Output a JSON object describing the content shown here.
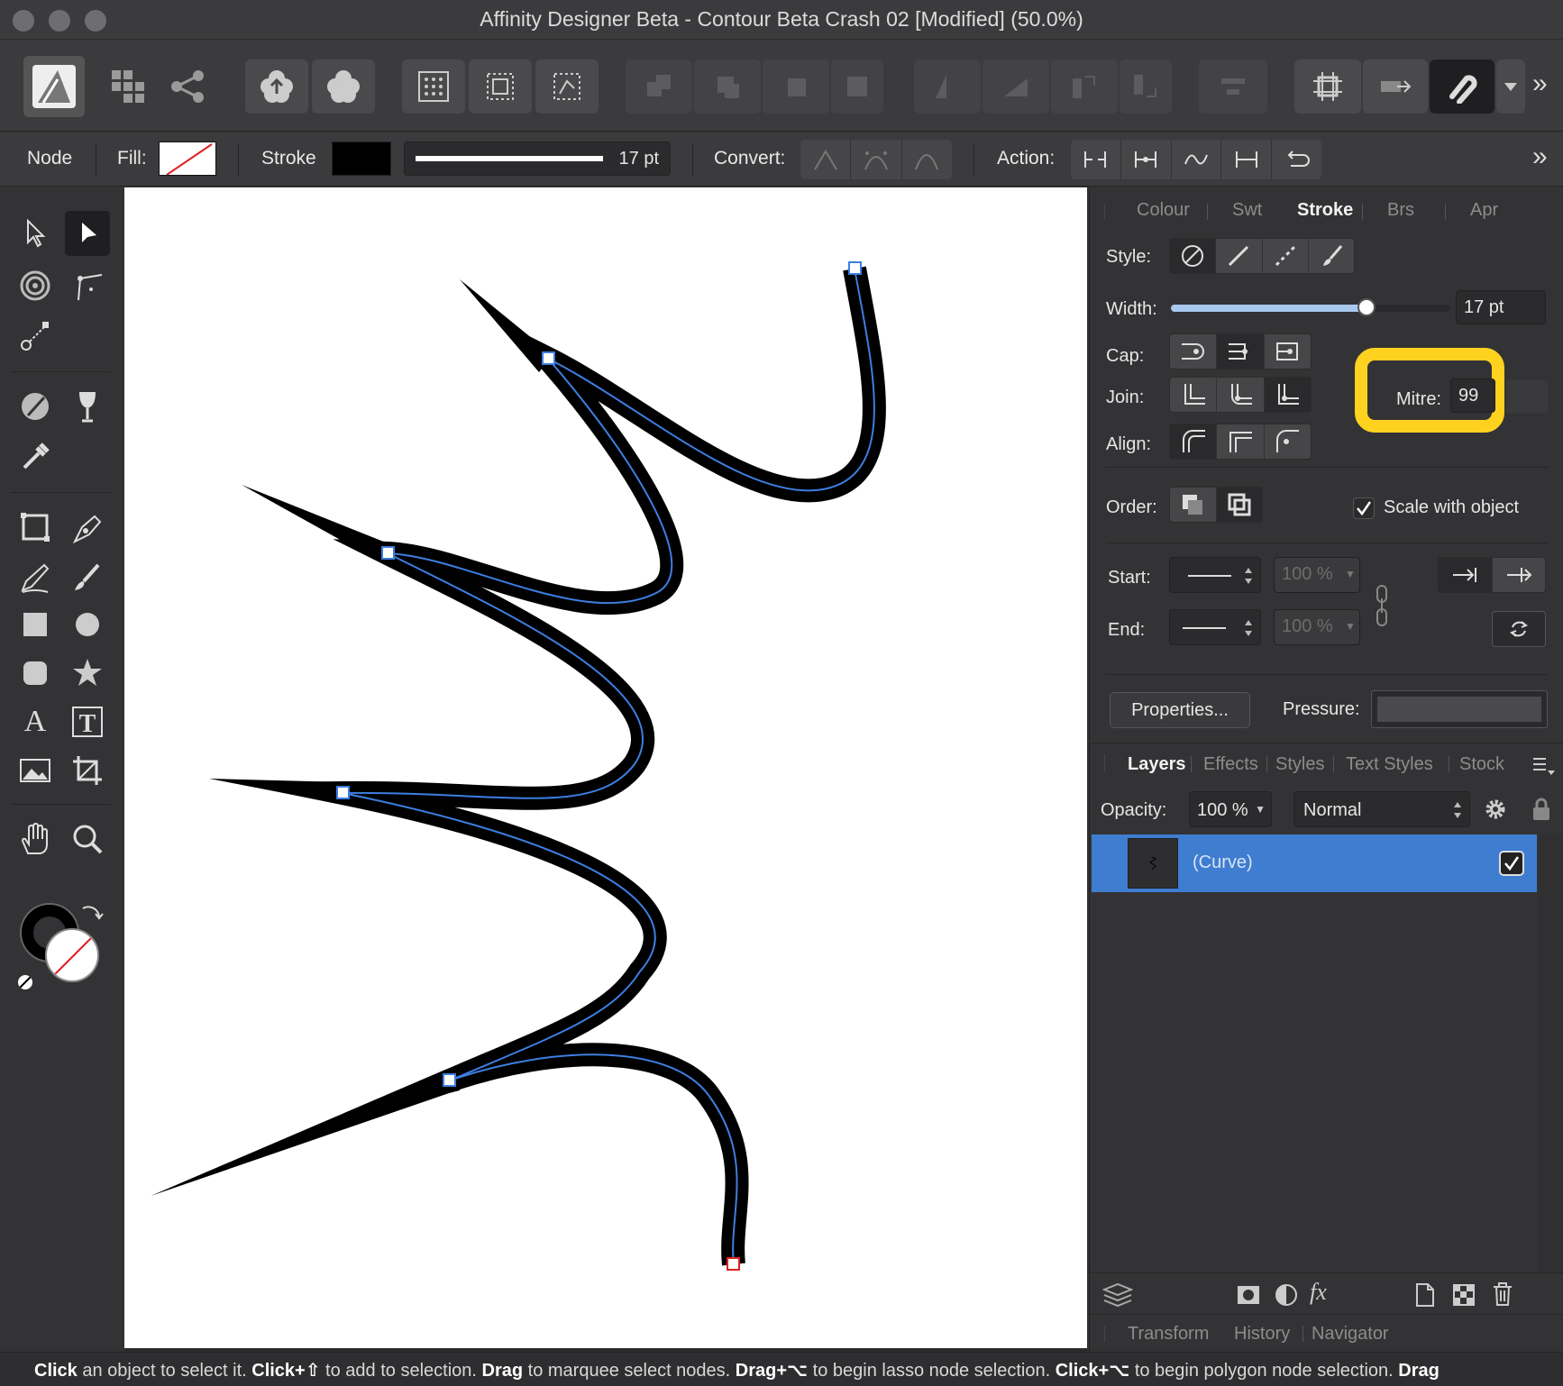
{
  "window": {
    "title": "Affinity Designer Beta - Contour Beta Crash 02 [Modified] (50.0%)"
  },
  "context_toolbar": {
    "mode_label": "Node",
    "fill_label": "Fill:",
    "stroke_label": "Stroke",
    "stroke_width_value": "17 pt",
    "convert_label": "Convert:",
    "action_label": "Action:"
  },
  "stroke_panel": {
    "tabs": [
      "Colour",
      "Swt",
      "Stroke",
      "Brs",
      "Apr"
    ],
    "active_tab": "Stroke",
    "style_label": "Style:",
    "width_label": "Width:",
    "width_value": "17 pt",
    "width_slider_fraction": 0.7,
    "cap_label": "Cap:",
    "join_label": "Join:",
    "align_label": "Align:",
    "mitre_label": "Mitre:",
    "mitre_value": "99",
    "order_label": "Order:",
    "scale_with_object_label": "Scale with object",
    "scale_with_object_checked": true,
    "start_label": "Start:",
    "end_label": "End:",
    "start_percent": "100 %",
    "end_percent": "100 %",
    "properties_button": "Properties...",
    "pressure_label": "Pressure:",
    "highlight_color": "#ffd21f"
  },
  "layers_panel": {
    "tabs": [
      "Layers",
      "Effects",
      "Styles",
      "Text Styles",
      "Stock"
    ],
    "active_tab": "Layers",
    "opacity_label": "Opacity:",
    "opacity_value": "100 %",
    "blend_mode": "Normal",
    "layers": [
      {
        "name": "(Curve)",
        "visible": true,
        "selected": true
      }
    ],
    "selection_color": "#3f7dd1"
  },
  "bottom_tabs": [
    "Transform",
    "History",
    "Navigator"
  ],
  "status": {
    "b1": "Click",
    "t1": " an object to select it. ",
    "b2": "Click+⇧",
    "t2": " to add to selection. ",
    "b3": "Drag",
    "t3": " to marquee select nodes. ",
    "b4": "Drag+⌥",
    "t4": " to begin lasso node selection. ",
    "b5": "Click+⌥",
    "t5": " to begin polygon node selection. ",
    "b6": "Drag"
  }
}
